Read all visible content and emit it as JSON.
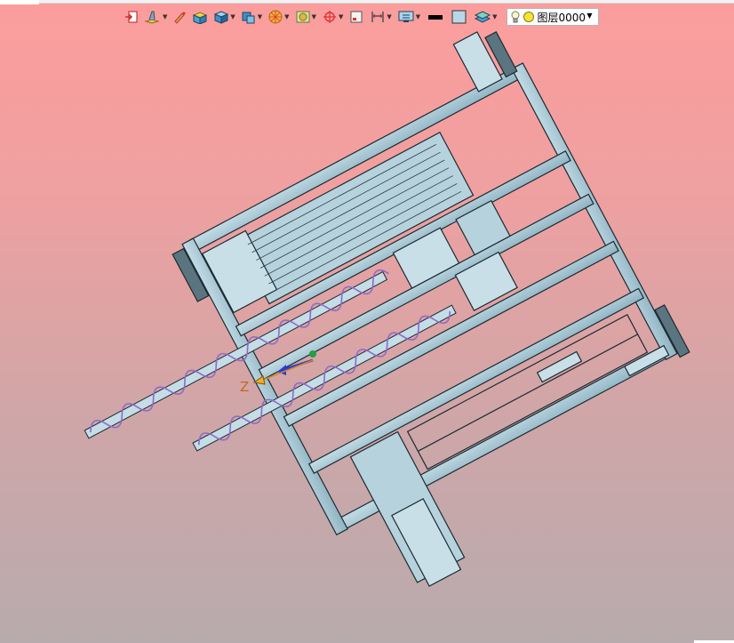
{
  "toolbar": {
    "items": [
      {
        "icon": "exit-icon",
        "has_dropdown": false
      },
      {
        "icon": "sketch-tool-icon",
        "has_dropdown": true
      },
      {
        "icon": "pencil-icon",
        "has_dropdown": false
      },
      {
        "icon": "solid-box-icon",
        "has_dropdown": false
      },
      {
        "icon": "blue-cube-icon",
        "has_dropdown": true
      },
      {
        "icon": "view-cube-icon",
        "has_dropdown": true
      },
      {
        "icon": "render-sphere-icon",
        "has_dropdown": true
      },
      {
        "icon": "section-box-icon",
        "has_dropdown": true
      },
      {
        "icon": "target-snap-icon",
        "has_dropdown": true
      },
      {
        "icon": "frame-icon",
        "has_dropdown": false
      },
      {
        "icon": "dimension-icon",
        "has_dropdown": true
      },
      {
        "icon": "display-mode-icon",
        "has_dropdown": true
      },
      {
        "icon": "line-color-icon",
        "has_dropdown": false
      },
      {
        "icon": "fill-color-icon",
        "has_dropdown": false
      },
      {
        "icon": "layer-stack-icon",
        "has_dropdown": true
      }
    ],
    "layer": {
      "name": "图层0000",
      "bulb_icon": "lightbulb-icon",
      "state_icon": "yellow-circle-icon"
    }
  },
  "viewport": {
    "background_top": "#fc9d9d",
    "background_bottom": "#b8abad",
    "model_color": "#a9ccd8",
    "spiral_color": "#8f6ac8",
    "axis_label": "Z"
  }
}
